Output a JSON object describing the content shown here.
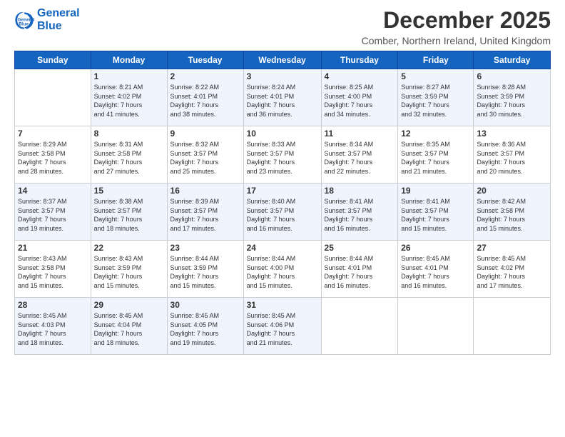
{
  "header": {
    "logo_line1": "General",
    "logo_line2": "Blue",
    "month": "December 2025",
    "location": "Comber, Northern Ireland, United Kingdom"
  },
  "weekdays": [
    "Sunday",
    "Monday",
    "Tuesday",
    "Wednesday",
    "Thursday",
    "Friday",
    "Saturday"
  ],
  "weeks": [
    [
      {
        "day": "",
        "info": ""
      },
      {
        "day": "1",
        "info": "Sunrise: 8:21 AM\nSunset: 4:02 PM\nDaylight: 7 hours\nand 41 minutes."
      },
      {
        "day": "2",
        "info": "Sunrise: 8:22 AM\nSunset: 4:01 PM\nDaylight: 7 hours\nand 38 minutes."
      },
      {
        "day": "3",
        "info": "Sunrise: 8:24 AM\nSunset: 4:01 PM\nDaylight: 7 hours\nand 36 minutes."
      },
      {
        "day": "4",
        "info": "Sunrise: 8:25 AM\nSunset: 4:00 PM\nDaylight: 7 hours\nand 34 minutes."
      },
      {
        "day": "5",
        "info": "Sunrise: 8:27 AM\nSunset: 3:59 PM\nDaylight: 7 hours\nand 32 minutes."
      },
      {
        "day": "6",
        "info": "Sunrise: 8:28 AM\nSunset: 3:59 PM\nDaylight: 7 hours\nand 30 minutes."
      }
    ],
    [
      {
        "day": "7",
        "info": "Sunrise: 8:29 AM\nSunset: 3:58 PM\nDaylight: 7 hours\nand 28 minutes."
      },
      {
        "day": "8",
        "info": "Sunrise: 8:31 AM\nSunset: 3:58 PM\nDaylight: 7 hours\nand 27 minutes."
      },
      {
        "day": "9",
        "info": "Sunrise: 8:32 AM\nSunset: 3:57 PM\nDaylight: 7 hours\nand 25 minutes."
      },
      {
        "day": "10",
        "info": "Sunrise: 8:33 AM\nSunset: 3:57 PM\nDaylight: 7 hours\nand 23 minutes."
      },
      {
        "day": "11",
        "info": "Sunrise: 8:34 AM\nSunset: 3:57 PM\nDaylight: 7 hours\nand 22 minutes."
      },
      {
        "day": "12",
        "info": "Sunrise: 8:35 AM\nSunset: 3:57 PM\nDaylight: 7 hours\nand 21 minutes."
      },
      {
        "day": "13",
        "info": "Sunrise: 8:36 AM\nSunset: 3:57 PM\nDaylight: 7 hours\nand 20 minutes."
      }
    ],
    [
      {
        "day": "14",
        "info": "Sunrise: 8:37 AM\nSunset: 3:57 PM\nDaylight: 7 hours\nand 19 minutes."
      },
      {
        "day": "15",
        "info": "Sunrise: 8:38 AM\nSunset: 3:57 PM\nDaylight: 7 hours\nand 18 minutes."
      },
      {
        "day": "16",
        "info": "Sunrise: 8:39 AM\nSunset: 3:57 PM\nDaylight: 7 hours\nand 17 minutes."
      },
      {
        "day": "17",
        "info": "Sunrise: 8:40 AM\nSunset: 3:57 PM\nDaylight: 7 hours\nand 16 minutes."
      },
      {
        "day": "18",
        "info": "Sunrise: 8:41 AM\nSunset: 3:57 PM\nDaylight: 7 hours\nand 16 minutes."
      },
      {
        "day": "19",
        "info": "Sunrise: 8:41 AM\nSunset: 3:57 PM\nDaylight: 7 hours\nand 15 minutes."
      },
      {
        "day": "20",
        "info": "Sunrise: 8:42 AM\nSunset: 3:58 PM\nDaylight: 7 hours\nand 15 minutes."
      }
    ],
    [
      {
        "day": "21",
        "info": "Sunrise: 8:43 AM\nSunset: 3:58 PM\nDaylight: 7 hours\nand 15 minutes."
      },
      {
        "day": "22",
        "info": "Sunrise: 8:43 AM\nSunset: 3:59 PM\nDaylight: 7 hours\nand 15 minutes."
      },
      {
        "day": "23",
        "info": "Sunrise: 8:44 AM\nSunset: 3:59 PM\nDaylight: 7 hours\nand 15 minutes."
      },
      {
        "day": "24",
        "info": "Sunrise: 8:44 AM\nSunset: 4:00 PM\nDaylight: 7 hours\nand 15 minutes."
      },
      {
        "day": "25",
        "info": "Sunrise: 8:44 AM\nSunset: 4:01 PM\nDaylight: 7 hours\nand 16 minutes."
      },
      {
        "day": "26",
        "info": "Sunrise: 8:45 AM\nSunset: 4:01 PM\nDaylight: 7 hours\nand 16 minutes."
      },
      {
        "day": "27",
        "info": "Sunrise: 8:45 AM\nSunset: 4:02 PM\nDaylight: 7 hours\nand 17 minutes."
      }
    ],
    [
      {
        "day": "28",
        "info": "Sunrise: 8:45 AM\nSunset: 4:03 PM\nDaylight: 7 hours\nand 18 minutes."
      },
      {
        "day": "29",
        "info": "Sunrise: 8:45 AM\nSunset: 4:04 PM\nDaylight: 7 hours\nand 18 minutes."
      },
      {
        "day": "30",
        "info": "Sunrise: 8:45 AM\nSunset: 4:05 PM\nDaylight: 7 hours\nand 19 minutes."
      },
      {
        "day": "31",
        "info": "Sunrise: 8:45 AM\nSunset: 4:06 PM\nDaylight: 7 hours\nand 21 minutes."
      },
      {
        "day": "",
        "info": ""
      },
      {
        "day": "",
        "info": ""
      },
      {
        "day": "",
        "info": ""
      }
    ]
  ]
}
